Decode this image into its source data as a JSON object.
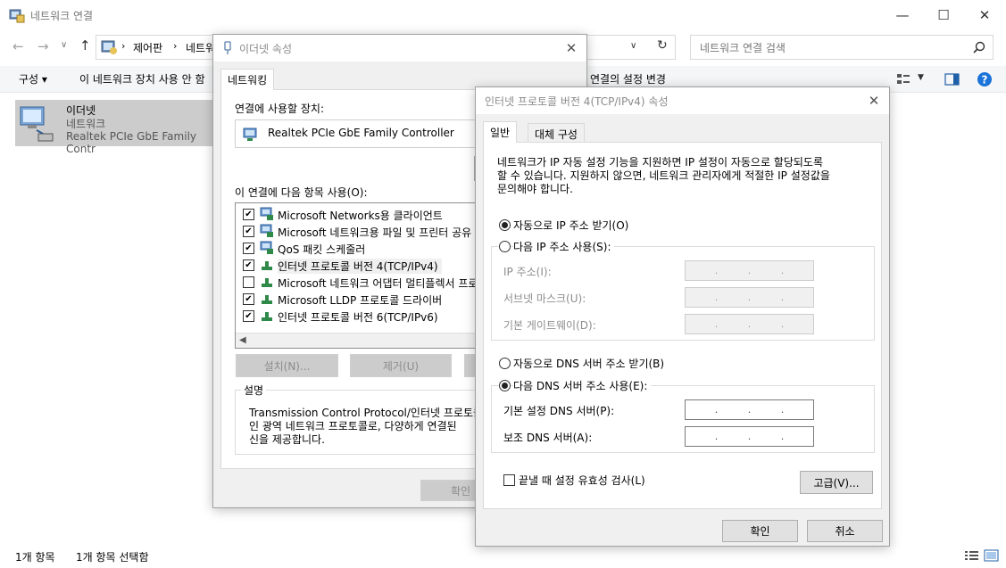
{
  "explorer": {
    "title": "네트워크 연결",
    "breadcrumb": [
      "제어판",
      "네트워"
    ],
    "search_placeholder": "네트워크 연결 검색",
    "commands": [
      "구성 ▾",
      "이 네트워크 장치 사용 안 함",
      "연결의 설정 변경"
    ],
    "adapter": {
      "name": "이더넷",
      "network": "네트워크",
      "device": "Realtek PCIe GbE Family Contr"
    },
    "status_left": "1개 항목",
    "status_selected": "1개 항목 선택함"
  },
  "ethernet_dialog": {
    "title": "이더넷 속성",
    "tab": "네트워킹",
    "connect_using_label": "연결에 사용할 장치:",
    "device": "Realtek PCIe GbE Family Controller",
    "items_label": "이 연결에 다음 항목 사용(O):",
    "items": [
      {
        "label": "Microsoft Networks용 클라이언트",
        "checked": true
      },
      {
        "label": "Microsoft 네트워크용 파일 및 프린터 공유",
        "checked": true
      },
      {
        "label": "QoS 패킷 스케줄러",
        "checked": true
      },
      {
        "label": "인터넷 프로토콜 버전 4(TCP/IPv4)",
        "checked": true
      },
      {
        "label": "Microsoft 네트워크 어댑터 멀티플렉서 프로",
        "checked": false
      },
      {
        "label": "Microsoft LLDP 프로토콜 드라이버",
        "checked": true
      },
      {
        "label": "인터넷 프로토콜 버전 6(TCP/IPv6)",
        "checked": true
      }
    ],
    "install_btn": "설치(N)...",
    "uninstall_btn": "제거(U)",
    "description_title": "설명",
    "description_lines": [
      "Transmission Control Protocol/인터넷 프로토콜",
      "인 광역 네트워크 프로토콜로, 다양하게 연결된",
      "신을 제공합니다."
    ],
    "ok_btn": "확인"
  },
  "ipv4_dialog": {
    "title": "인터넷 프로토콜 버전 4(TCP/IPv4) 속성",
    "tab_general": "일반",
    "tab_alternate": "대체 구성",
    "intro_lines": [
      "네트워크가 IP 자동 설정 기능을 지원하면 IP 설정이 자동으로 할당되도록",
      "할 수 있습니다. 지원하지 않으면, 네트워크 관리자에게 적절한 IP 설정값을",
      "문의해야 합니다."
    ],
    "auto_ip": "자동으로 IP 주소 받기(O)",
    "manual_ip": "다음 IP 주소 사용(S):",
    "ip_label": "IP 주소(I):",
    "subnet_label": "서브넷 마스크(U):",
    "gateway_label": "기본 게이트웨이(D):",
    "auto_dns": "자동으로 DNS 서버 주소 받기(B)",
    "manual_dns": "다음 DNS 서버 주소 사용(E):",
    "preferred_dns": "기본 설정 DNS 서버(P):",
    "alternate_dns": "보조 DNS 서버(A):",
    "validate": "끝낼 때 설정 유효성 검사(L)",
    "advanced_btn": "고급(V)...",
    "ok_btn": "확인",
    "cancel_btn": "취소",
    "selected_ip_mode": "auto",
    "selected_dns_mode": "manual"
  },
  "colors": {
    "accent": "#0078d7",
    "help": "#1a73d9",
    "button_border": "#adadad"
  }
}
